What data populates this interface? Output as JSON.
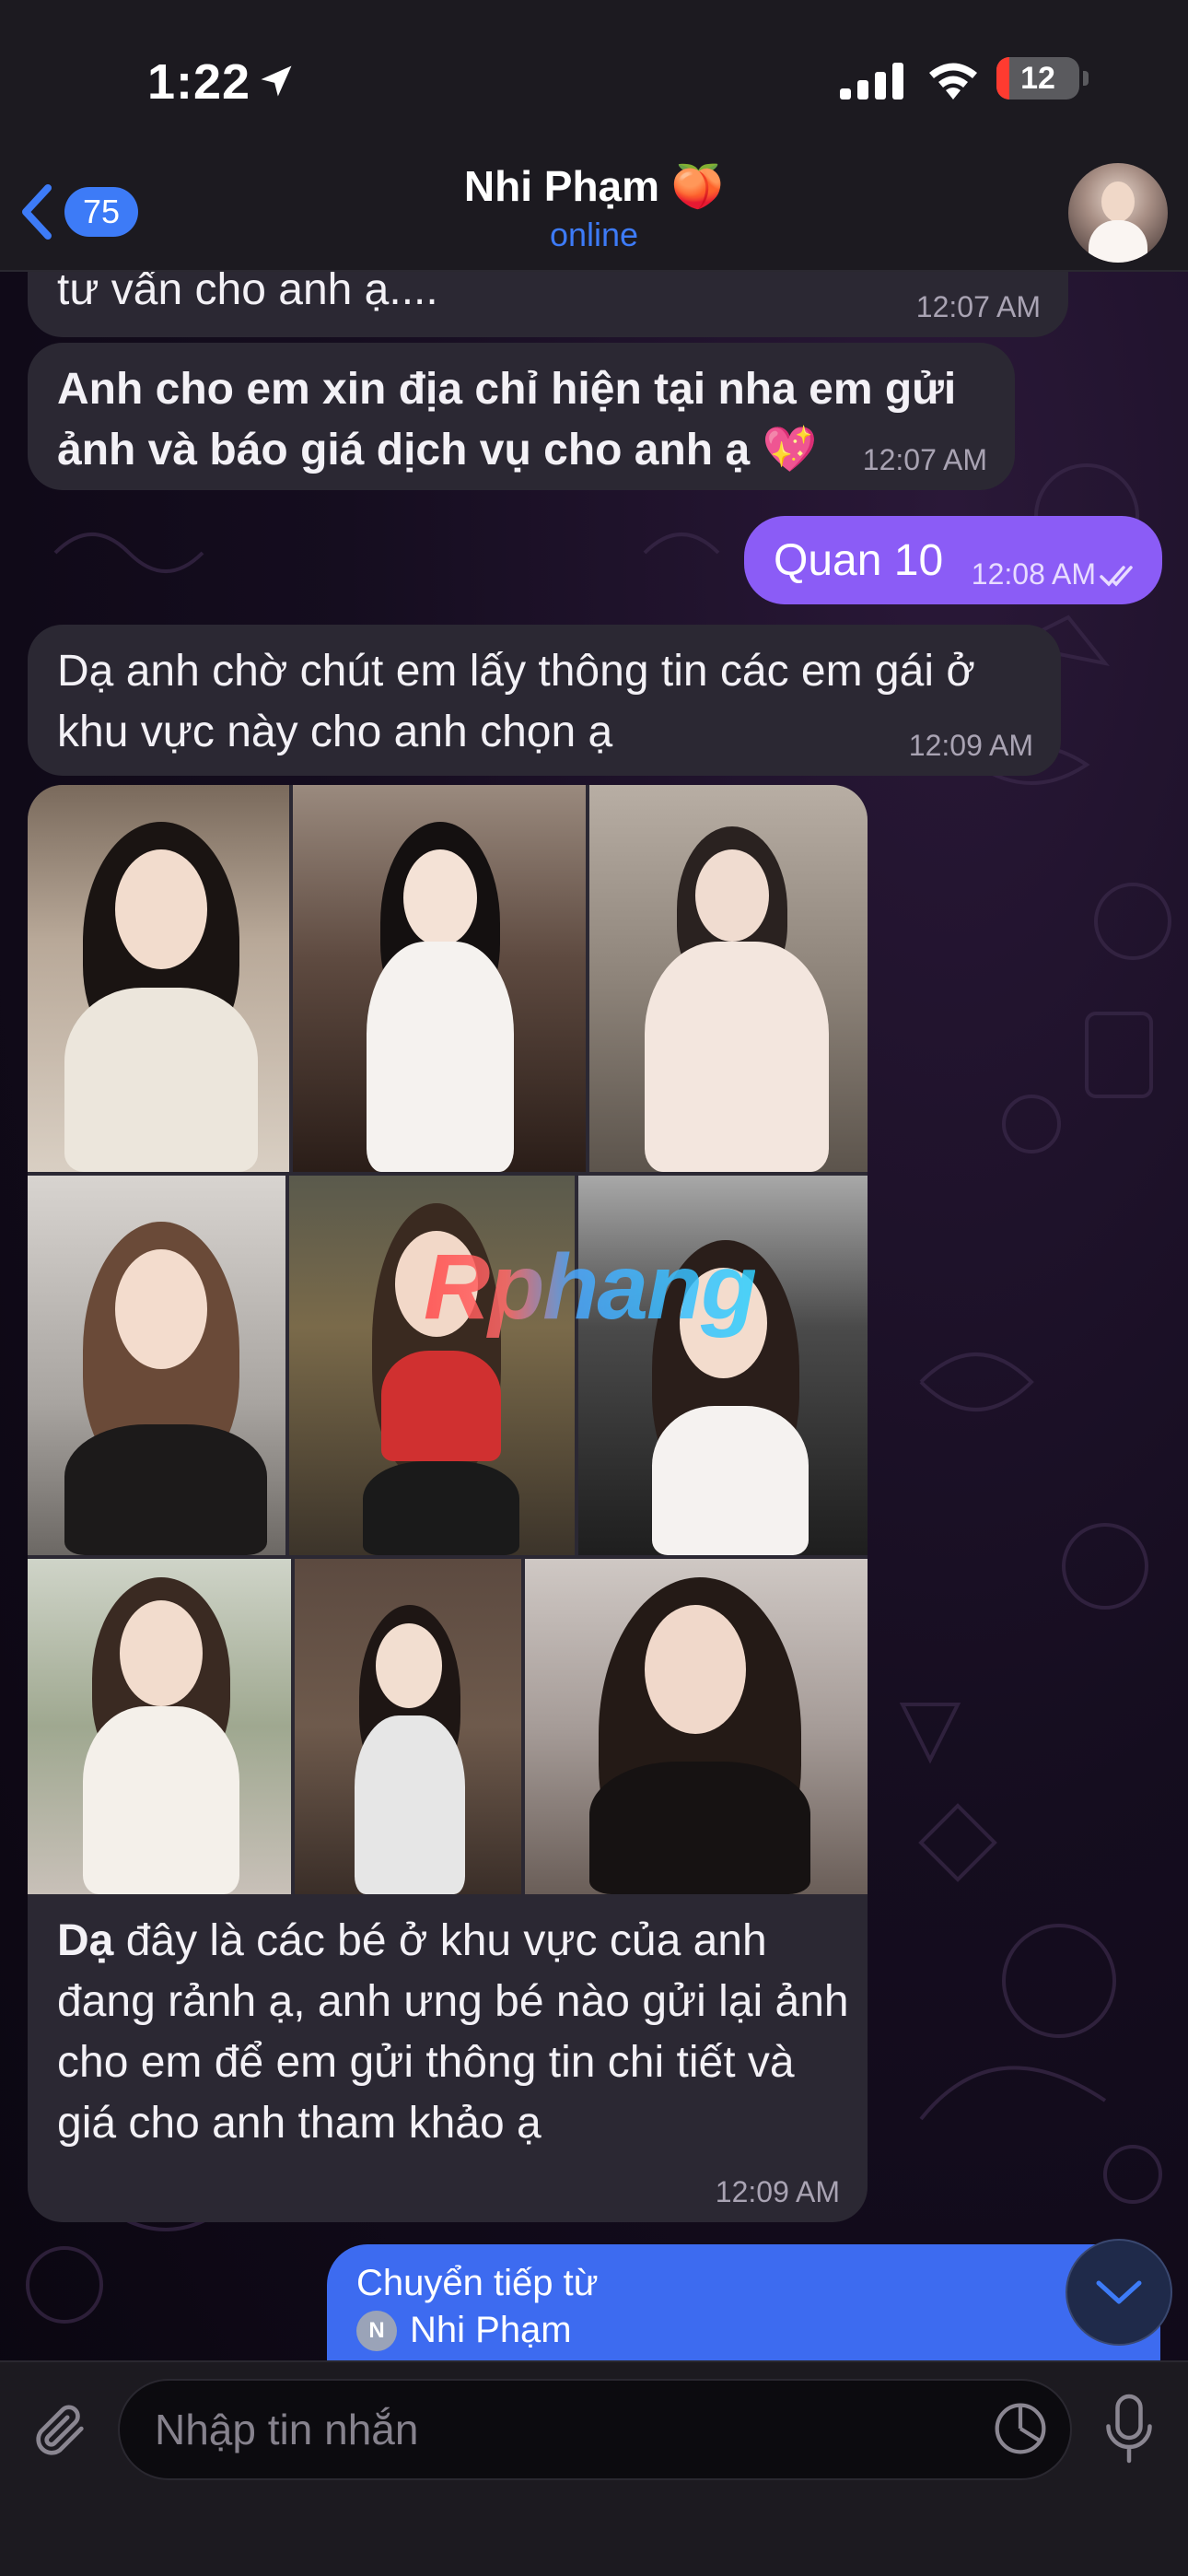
{
  "status_bar": {
    "time": "1:22",
    "battery": "12"
  },
  "header": {
    "back_count": "75",
    "contact_name": "Nhi Phạm 🍑",
    "status": "online"
  },
  "messages": [
    {
      "text": "tư vấn cho anh ạ....",
      "time": "12:07 AM"
    },
    {
      "text": "Anh cho em xin địa chỉ hiện tại nha em gửi ảnh và báo giá dịch vụ cho anh ạ 💖",
      "time": "12:07 AM"
    },
    {
      "text": "Quan 10",
      "time": "12:08 AM"
    },
    {
      "text": "Dạ anh chờ chút em lấy thông tin các em gái ở khu vực này cho anh chọn ạ",
      "time": "12:09 AM"
    },
    {
      "text_bold": "Dạ",
      "text": " đây là các bé ở khu vực của anh đang rảnh ạ, anh ưng bé nào gửi lại ảnh cho em để em gửi thông tin chi tiết và giá cho anh tham khảo ạ",
      "time": "12:09 AM"
    }
  ],
  "watermark": "Rphang",
  "forward": {
    "label": "Chuyển tiếp từ",
    "badge": "N",
    "from": "Nhi Phạm"
  },
  "input": {
    "placeholder": "Nhập tin nhắn"
  },
  "colors": {
    "accent": "#3d7bf7",
    "outgoing_bubble": "#8b5cf6",
    "incoming_bubble": "#2b2833",
    "forward_bubble": "#3d6bf0"
  },
  "icons": [
    "location-arrow-icon",
    "signal-icon",
    "wifi-icon",
    "battery-icon",
    "back-chevron-icon",
    "double-check-icon",
    "chevron-down-icon",
    "paperclip-icon",
    "sticker-icon",
    "microphone-icon"
  ]
}
